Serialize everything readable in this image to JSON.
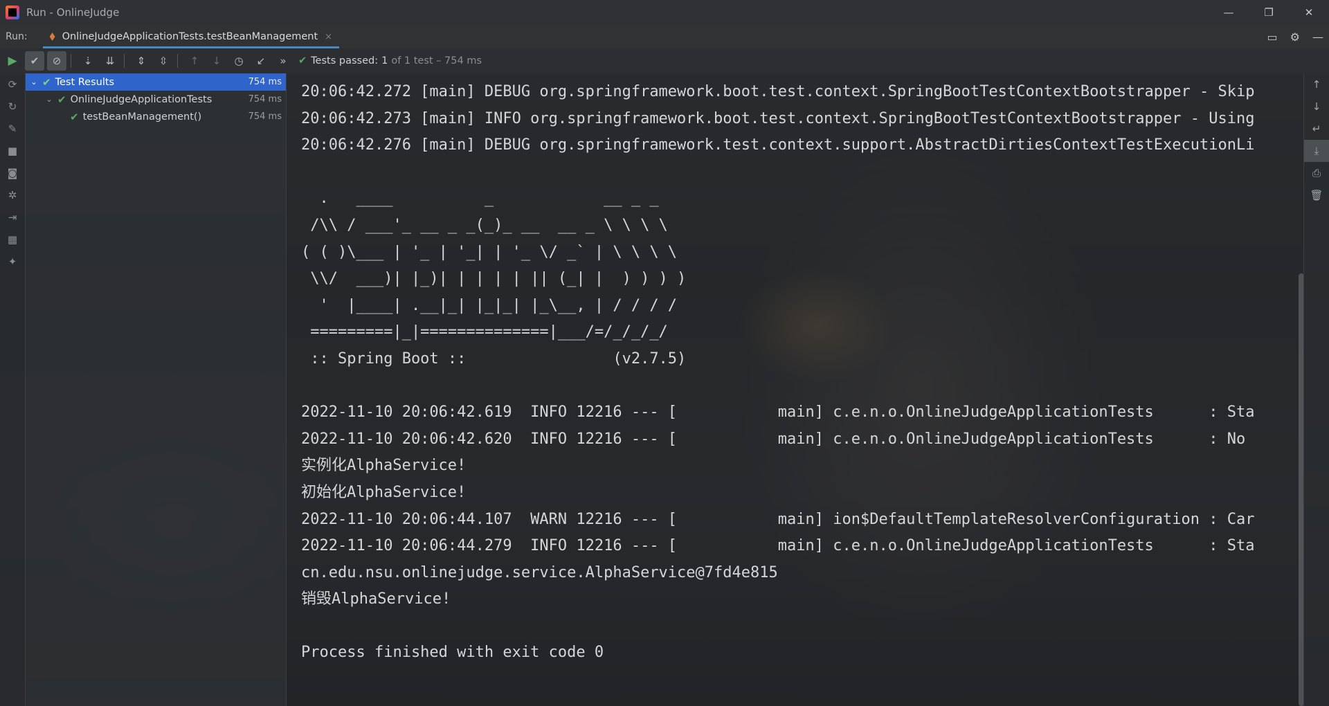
{
  "window": {
    "title": "Run - OnlineJudge",
    "minimize_icon": "minimize-icon",
    "restore_icon": "restore-icon",
    "close_icon": "close-icon"
  },
  "runbar": {
    "label": "Run:",
    "tab_label": "OnlineJudgeApplicationTests.testBeanManagement",
    "tab_close": "×"
  },
  "toolbar": {
    "status_prefix": "Tests passed:",
    "status_count": "1",
    "status_suffix": "of 1 test – 754 ms",
    "more": "»"
  },
  "tree": {
    "items": [
      {
        "label": "Test Results",
        "time": "754 ms"
      },
      {
        "label": "OnlineJudgeApplicationTests",
        "time": "754 ms"
      },
      {
        "label": "testBeanManagement()",
        "time": "754 ms"
      }
    ]
  },
  "console": {
    "lines": [
      "20:06:42.272 [main] DEBUG org.springframework.boot.test.context.SpringBootTestContextBootstrapper - Skip",
      "20:06:42.273 [main] INFO org.springframework.boot.test.context.SpringBootTestContextBootstrapper - Using",
      "20:06:42.276 [main] DEBUG org.springframework.test.context.support.AbstractDirtiesContextTestExecutionLi",
      "",
      "  .   ____          _            __ _ _",
      " /\\\\ / ___'_ __ _ _(_)_ __  __ _ \\ \\ \\ \\",
      "( ( )\\___ | '_ | '_| | '_ \\/ _` | \\ \\ \\ \\",
      " \\\\/  ___)| |_)| | | | | || (_| |  ) ) ) )",
      "  '  |____| .__|_| |_|_| |_\\__, | / / / /",
      " =========|_|==============|___/=/_/_/_/",
      " :: Spring Boot ::                (v2.7.5)",
      "",
      "2022-11-10 20:06:42.619  INFO 12216 --- [           main] c.e.n.o.OnlineJudgeApplicationTests      : Sta",
      "2022-11-10 20:06:42.620  INFO 12216 --- [           main] c.e.n.o.OnlineJudgeApplicationTests      : No",
      "实例化AlphaService!",
      "初始化AlphaService!",
      "2022-11-10 20:06:44.107  WARN 12216 --- [           main] ion$DefaultTemplateResolverConfiguration : Car",
      "2022-11-10 20:06:44.279  INFO 12216 --- [           main] c.e.n.o.OnlineJudgeApplicationTests      : Sta",
      "cn.edu.nsu.onlinejudge.service.AlphaService@7fd4e815",
      "销毁AlphaService!",
      "",
      "Process finished with exit code 0"
    ]
  }
}
